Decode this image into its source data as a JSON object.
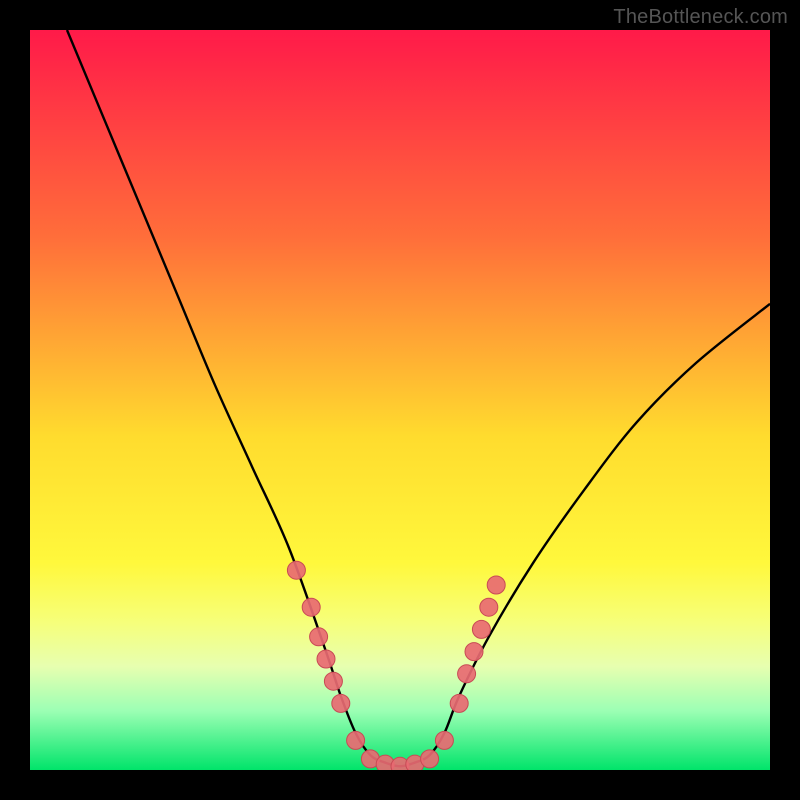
{
  "watermark": {
    "text": "TheBottleneck.com"
  },
  "colors": {
    "frame": "#000000",
    "gradient_stops": [
      {
        "offset": 0.0,
        "color": "#ff1a49"
      },
      {
        "offset": 0.28,
        "color": "#ff6e3a"
      },
      {
        "offset": 0.55,
        "color": "#ffdc2e"
      },
      {
        "offset": 0.72,
        "color": "#fff83c"
      },
      {
        "offset": 0.8,
        "color": "#f6ff7a"
      },
      {
        "offset": 0.86,
        "color": "#e7ffb0"
      },
      {
        "offset": 0.92,
        "color": "#9cffb4"
      },
      {
        "offset": 1.0,
        "color": "#00e46a"
      }
    ],
    "curve": "#000000",
    "markers_fill": "#e86a72",
    "markers_stroke": "#c84a55"
  },
  "chart_data": {
    "type": "line",
    "title": "",
    "xlabel": "",
    "ylabel": "",
    "xlim": [
      0,
      100
    ],
    "ylim": [
      0,
      100
    ],
    "series": [
      {
        "name": "bottleneck-curve",
        "x": [
          5,
          10,
          15,
          20,
          25,
          30,
          35,
          40,
          42,
          44,
          46,
          48,
          50,
          52,
          54,
          56,
          58,
          62,
          68,
          75,
          82,
          90,
          100
        ],
        "y": [
          100,
          88,
          76,
          64,
          52,
          41,
          30,
          16,
          10,
          5,
          2,
          1,
          0.5,
          1,
          2,
          5,
          10,
          18,
          28,
          38,
          47,
          55,
          63
        ]
      }
    ],
    "markers": {
      "name": "highlighted-points",
      "points": [
        {
          "x": 36,
          "y": 27
        },
        {
          "x": 38,
          "y": 22
        },
        {
          "x": 39,
          "y": 18
        },
        {
          "x": 40,
          "y": 15
        },
        {
          "x": 41,
          "y": 12
        },
        {
          "x": 42,
          "y": 9
        },
        {
          "x": 44,
          "y": 4
        },
        {
          "x": 46,
          "y": 1.5
        },
        {
          "x": 48,
          "y": 0.8
        },
        {
          "x": 50,
          "y": 0.5
        },
        {
          "x": 52,
          "y": 0.8
        },
        {
          "x": 54,
          "y": 1.5
        },
        {
          "x": 56,
          "y": 4
        },
        {
          "x": 58,
          "y": 9
        },
        {
          "x": 59,
          "y": 13
        },
        {
          "x": 60,
          "y": 16
        },
        {
          "x": 61,
          "y": 19
        },
        {
          "x": 62,
          "y": 22
        },
        {
          "x": 63,
          "y": 25
        }
      ]
    }
  }
}
